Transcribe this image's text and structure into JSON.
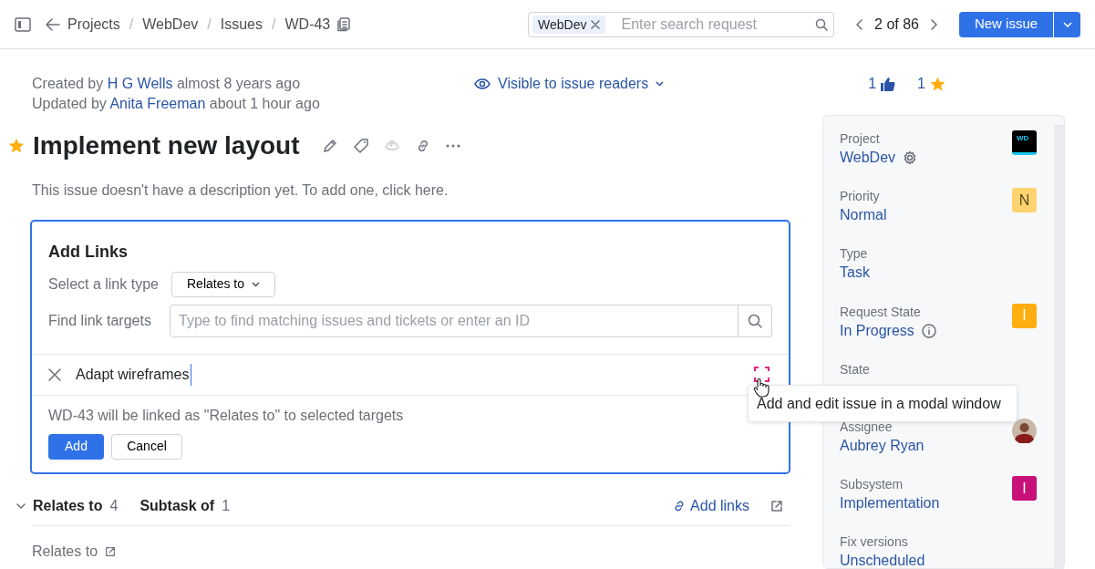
{
  "breadcrumbs": [
    "Projects",
    "WebDev",
    "Issues",
    "WD-43"
  ],
  "breadcrumb_separator": "/",
  "search": {
    "tag": "WebDev",
    "placeholder": "Enter search request"
  },
  "pager": {
    "text": "2 of 86"
  },
  "new_issue_button": "New issue",
  "meta": [
    {
      "prefix": "Created by",
      "user": "H G Wells",
      "suffix": "almost 8 years ago"
    },
    {
      "prefix": "Updated by",
      "user": "Anita Freeman",
      "suffix": "about 1 hour ago"
    }
  ],
  "visibility": "Visible to issue readers",
  "votes": "1",
  "stars": "1",
  "title": "Implement new layout",
  "starred": true,
  "description": "This issue doesn't have a description yet. To add one, click here.",
  "add_links": {
    "heading": "Add Links",
    "type_label": "Select a link type",
    "type_value": "Relates to",
    "targets_label": "Find link targets",
    "targets_placeholder": "Type to find matching issues and tickets or enter an ID",
    "new_item": "Adapt wireframes",
    "note": "WD-43 will be linked as \"Relates to\" to selected targets",
    "add_button": "Add",
    "cancel_button": "Cancel"
  },
  "tooltip": "Add and edit issue in a modal window",
  "link_tabs": [
    {
      "label": "Relates to",
      "count": "4"
    },
    {
      "label": "Subtask of",
      "count": "1"
    }
  ],
  "add_links_link": "Add links",
  "relates_heading": "Relates to",
  "fields": [
    {
      "label": "Project",
      "value": "WebDev",
      "kind": "project",
      "badge": "WD"
    },
    {
      "label": "Priority",
      "value": "Normal",
      "kind": "letter",
      "badge": "N",
      "color": "#ffd470"
    },
    {
      "label": "Type",
      "value": "Task",
      "kind": "none"
    },
    {
      "label": "Request State",
      "value": "In Progress",
      "kind": "letter",
      "badge": "I",
      "color": "#ffae0f",
      "info": true
    },
    {
      "label": "State",
      "kind": "none"
    },
    {
      "label": "Assignee",
      "value": "Aubrey Ryan",
      "kind": "avatar"
    },
    {
      "label": "Subsystem",
      "value": "Implementation",
      "kind": "letter",
      "badge": "I",
      "color": "#c8107a"
    },
    {
      "label": "Fix versions",
      "value": "Unscheduled",
      "kind": "none"
    }
  ]
}
